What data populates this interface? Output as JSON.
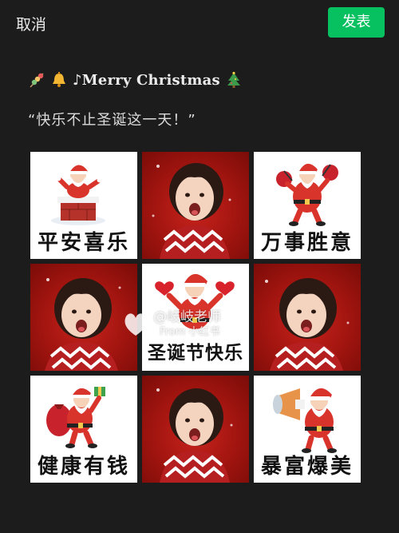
{
  "topbar": {
    "cancel_label": "取消",
    "publish_label": "发表",
    "publish_color": "#07c160"
  },
  "post": {
    "emoji_icons": [
      "tanghulu-icon",
      "bell-icon",
      "christmas-tree-icon"
    ],
    "title_text": "♪Merry Christmas",
    "quote_text": "“快乐不止圣诞这一天！”"
  },
  "grid": {
    "tiles": [
      {
        "type": "sticker",
        "icon": "santa-chimney-icon",
        "caption": "平安喜乐"
      },
      {
        "type": "photo",
        "icon": "child-photo"
      },
      {
        "type": "sticker",
        "icon": "santa-gift-bags-icon",
        "caption": "万事胜意"
      },
      {
        "type": "photo",
        "icon": "child-photo"
      },
      {
        "type": "sticker",
        "icon": "santa-hearts-icon",
        "caption": "圣诞节快乐"
      },
      {
        "type": "photo",
        "icon": "child-photo"
      },
      {
        "type": "sticker",
        "icon": "santa-gift-sack-icon",
        "caption": "健康有钱"
      },
      {
        "type": "photo",
        "icon": "child-photo"
      },
      {
        "type": "sticker",
        "icon": "santa-megaphone-icon",
        "caption": "暴富爆美"
      }
    ]
  },
  "watermark": {
    "username": "@岐岐老师",
    "source": "From 小红书",
    "icon": "xiaohongshu-logo-icon"
  }
}
